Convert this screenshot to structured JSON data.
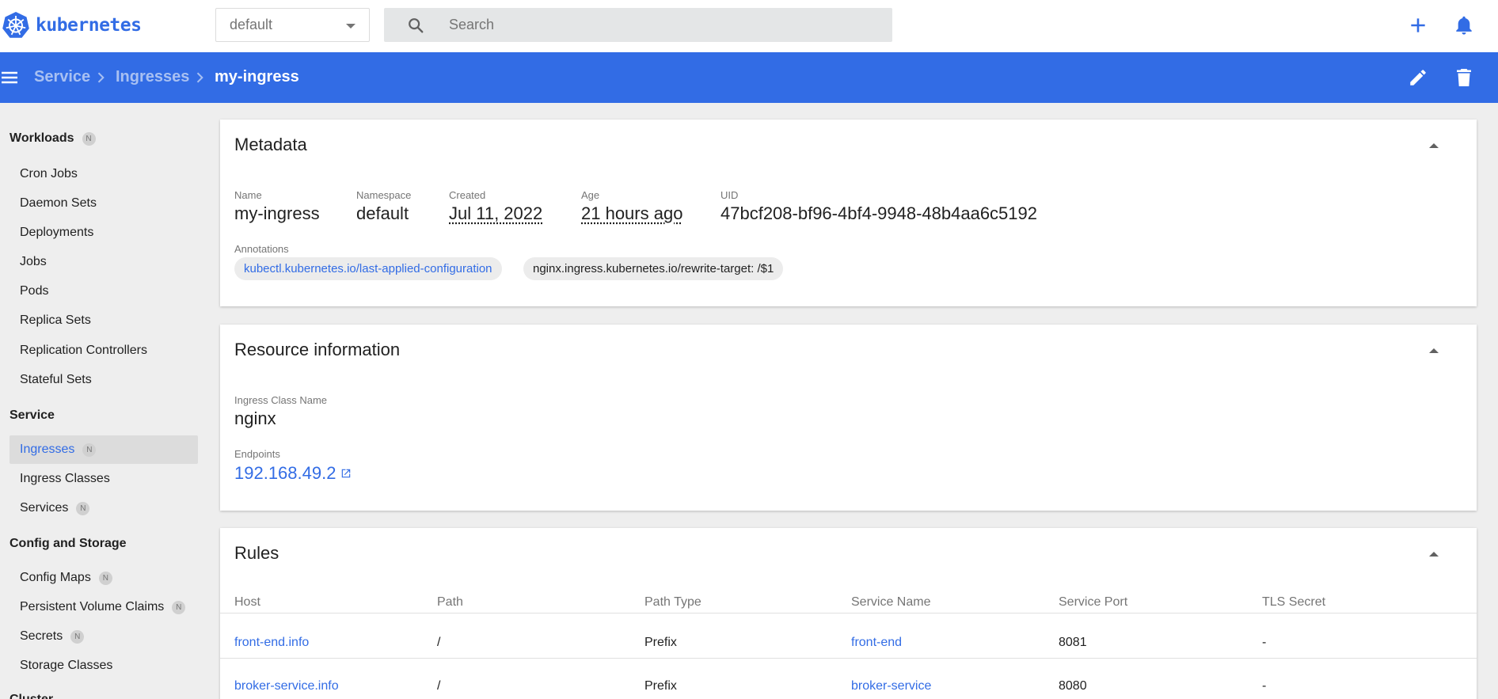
{
  "app": {
    "name": "kubernetes"
  },
  "header": {
    "namespace": "default",
    "search_placeholder": "Search",
    "create_icon": "plus-icon",
    "notifications_icon": "bell-icon"
  },
  "toolbar": {
    "breadcrumb": [
      "Service",
      "Ingresses",
      "my-ingress"
    ],
    "edit_icon": "pencil-icon",
    "delete_icon": "trash-icon"
  },
  "sidebar": {
    "workloads": {
      "label": "Workloads",
      "badge": "N",
      "items": [
        "Cron Jobs",
        "Daemon Sets",
        "Deployments",
        "Jobs",
        "Pods",
        "Replica Sets",
        "Replication Controllers",
        "Stateful Sets"
      ]
    },
    "service": {
      "label": "Service",
      "items": [
        {
          "label": "Ingresses",
          "badge": "N",
          "active": true
        },
        {
          "label": "Ingress Classes"
        },
        {
          "label": "Services",
          "badge": "N"
        }
      ]
    },
    "config": {
      "label": "Config and Storage",
      "items": [
        {
          "label": "Config Maps",
          "badge": "N"
        },
        {
          "label": "Persistent Volume Claims",
          "badge": "N"
        },
        {
          "label": "Secrets",
          "badge": "N"
        },
        {
          "label": "Storage Classes"
        }
      ]
    },
    "cluster": {
      "label": "Cluster"
    }
  },
  "metadata": {
    "title": "Metadata",
    "name_label": "Name",
    "name": "my-ingress",
    "namespace_label": "Namespace",
    "namespace": "default",
    "created_label": "Created",
    "created": "Jul 11, 2022",
    "age_label": "Age",
    "age": "21 hours ago",
    "uid_label": "UID",
    "uid": "47bcf208-bf96-4bf4-9948-48b4aa6c5192",
    "annotations_label": "Annotations",
    "annotations": [
      "kubectl.kubernetes.io/last-applied-configuration",
      "nginx.ingress.kubernetes.io/rewrite-target: /$1"
    ]
  },
  "resource": {
    "title": "Resource information",
    "class_label": "Ingress Class Name",
    "class": "nginx",
    "endpoints_label": "Endpoints",
    "endpoint": "192.168.49.2"
  },
  "rules": {
    "title": "Rules",
    "columns": [
      "Host",
      "Path",
      "Path Type",
      "Service Name",
      "Service Port",
      "TLS Secret"
    ],
    "rows": [
      [
        "front-end.info",
        "/",
        "Prefix",
        "front-end",
        "8081",
        "-"
      ],
      [
        "broker-service.info",
        "/",
        "Prefix",
        "broker-service",
        "8080",
        "-"
      ]
    ]
  },
  "colors": {
    "accent": "#326ce5",
    "background": "#eeeeee",
    "card": "#ffffff"
  }
}
